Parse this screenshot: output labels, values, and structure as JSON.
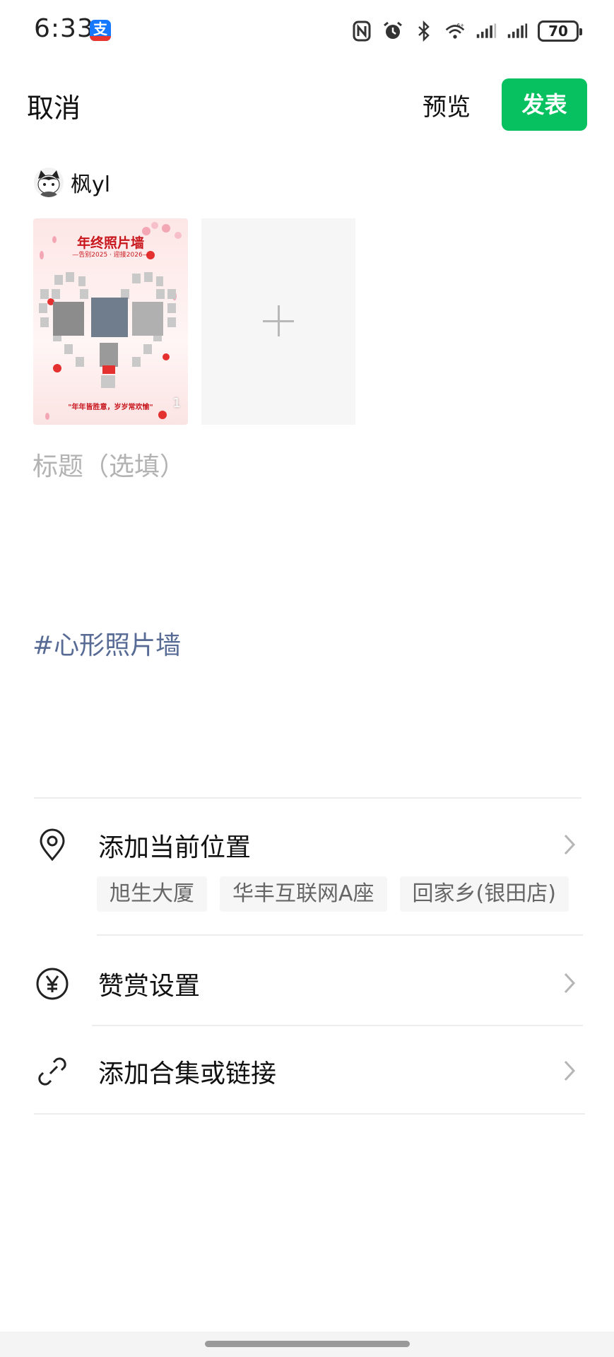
{
  "status_bar": {
    "time": "6:33",
    "app_icon_char": "支",
    "battery": "70",
    "icons": [
      "nfc-icon",
      "alarm-icon",
      "bluetooth-icon",
      "wifi-icon",
      "signal-icon",
      "signal-icon",
      "battery-icon"
    ]
  },
  "header": {
    "cancel": "取消",
    "preview": "预览",
    "publish": "发表",
    "publish_color": "#07c160"
  },
  "author": {
    "name": "枫yl"
  },
  "media": {
    "thumb_title": "年终照片墙",
    "thumb_subtitle": "—告别2025 · 迎接2026—",
    "thumb_footer": "\"年年皆胜意，岁岁常欢愉\"",
    "thumb_count": "1",
    "add_icon": "plus-icon"
  },
  "title_field": {
    "placeholder": "标题（选填）",
    "value": ""
  },
  "topic": "#心形照片墙",
  "topic_color": "#576b95",
  "location": {
    "label": "添加当前位置",
    "suggestions": [
      "旭生大厦",
      "华丰互联网A座",
      "回家乡(银田店)"
    ]
  },
  "reward": {
    "label": "赞赏设置"
  },
  "collection": {
    "label": "添加合集或链接"
  }
}
